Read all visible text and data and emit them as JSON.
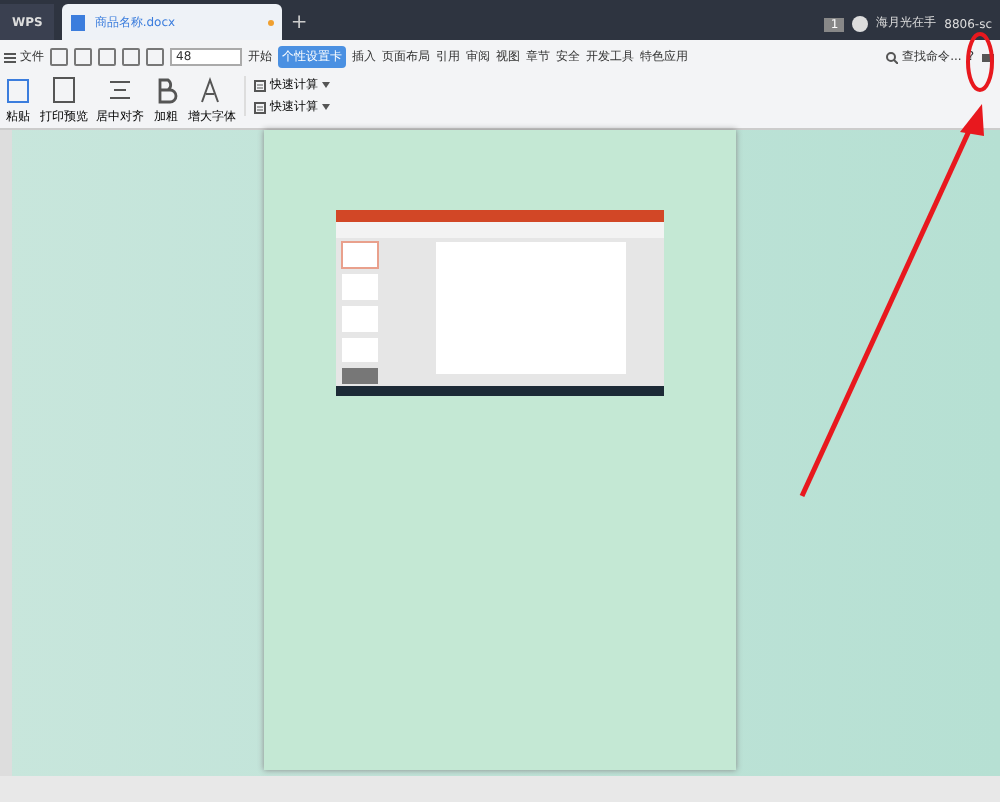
{
  "titlebar": {
    "app_tab": "WPS",
    "doc_tab": "商品名称.docx",
    "new_tab": "+",
    "page_number": "1",
    "user": "海月光在手",
    "account": "8806-sc"
  },
  "toolbar": {
    "file_menu": "文件",
    "font_size": "48"
  },
  "ribbon_tabs": [
    {
      "label": "开始",
      "selected": false
    },
    {
      "label": "个性设置卡",
      "selected": true
    },
    {
      "label": "插入",
      "selected": false
    },
    {
      "label": "页面布局",
      "selected": false
    },
    {
      "label": "引用",
      "selected": false
    },
    {
      "label": "审阅",
      "selected": false
    },
    {
      "label": "视图",
      "selected": false
    },
    {
      "label": "章节",
      "selected": false
    },
    {
      "label": "安全",
      "selected": false
    },
    {
      "label": "开发工具",
      "selected": false
    },
    {
      "label": "特色应用",
      "selected": false
    }
  ],
  "search": {
    "placeholder": "查找命令..."
  },
  "help": "?",
  "ribbon_buttons": [
    {
      "label": "粘贴",
      "kind": "paste"
    },
    {
      "label": "打印预览",
      "kind": "preview"
    },
    {
      "label": "居中对齐",
      "kind": "center"
    },
    {
      "label": "加粗",
      "kind": "bold"
    },
    {
      "label": "增大字体",
      "kind": "grow"
    }
  ],
  "quick_calc": [
    "快速计算",
    "快速计算"
  ]
}
